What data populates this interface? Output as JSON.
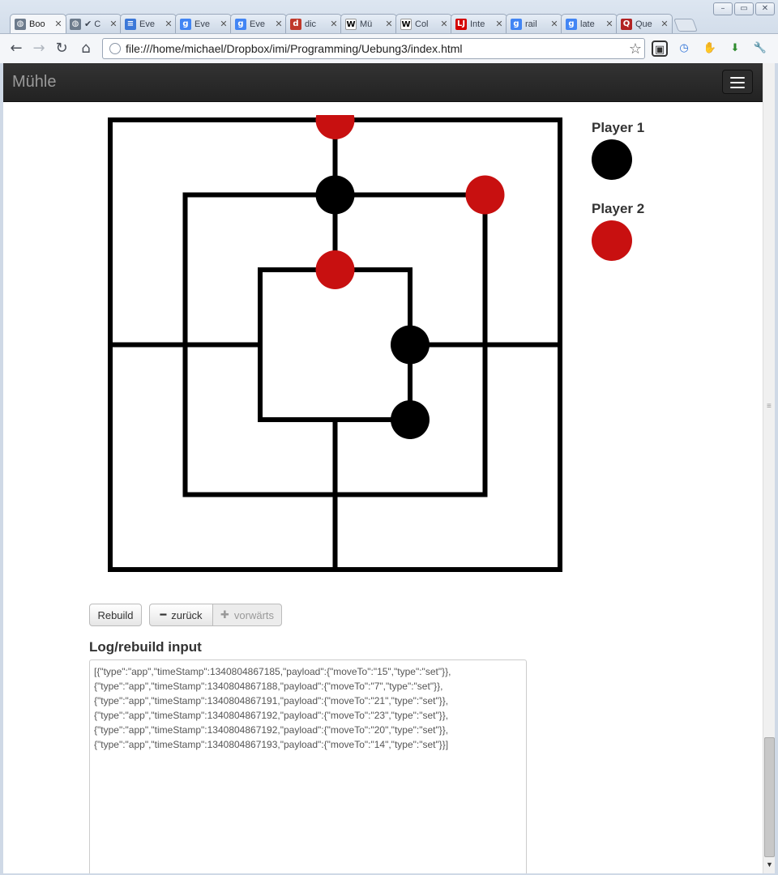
{
  "browser": {
    "tabs": [
      {
        "title": "Boo",
        "favicon": "globe-icon",
        "color": "#6d7b8c",
        "active": true
      },
      {
        "title": "✔ C",
        "favicon": "globe-icon",
        "color": "#6d7b8c",
        "active": false
      },
      {
        "title": "Eve",
        "favicon": "docs-icon",
        "color": "#3c78d8",
        "active": false
      },
      {
        "title": "Eve",
        "favicon": "google-icon",
        "color": "#4285f4",
        "active": false
      },
      {
        "title": "Eve",
        "favicon": "google-icon",
        "color": "#4285f4",
        "active": false
      },
      {
        "title": "dic",
        "favicon": "dict-icon",
        "color": "#c0392b",
        "active": false
      },
      {
        "title": "Mü",
        "favicon": "wikipedia-icon",
        "color": "#ffffff",
        "active": false
      },
      {
        "title": "Col",
        "favicon": "wikipedia-icon",
        "color": "#ffffff",
        "active": false
      },
      {
        "title": "Inte",
        "favicon": "lj-icon",
        "color": "#d40000",
        "active": false
      },
      {
        "title": "rail",
        "favicon": "google-icon",
        "color": "#4285f4",
        "active": false
      },
      {
        "title": "late",
        "favicon": "google-icon",
        "color": "#4285f4",
        "active": false
      },
      {
        "title": "Que",
        "favicon": "quest-icon",
        "color": "#b22222",
        "active": false
      }
    ],
    "address": "file:///home/michael/Dropbox/imi/Programming/Uebung3/index.html"
  },
  "app": {
    "brand": "Mühle",
    "menu_icon": "hamburger-menu-icon"
  },
  "board": {
    "line_color": "#000000",
    "black_color": "#000000",
    "red_color": "#c81010",
    "pieces": [
      {
        "ring": 0,
        "col": 1,
        "row": 0,
        "player": 2
      },
      {
        "ring": 1,
        "col": 1,
        "row": 0,
        "player": 1
      },
      {
        "ring": 1,
        "col": 2,
        "row": 0,
        "player": 2
      },
      {
        "ring": 2,
        "col": 1,
        "row": 0,
        "player": 2
      },
      {
        "ring": 2,
        "col": 2,
        "row": 1,
        "player": 1
      },
      {
        "ring": 2,
        "col": 2,
        "row": 2,
        "player": 1
      }
    ]
  },
  "players": {
    "p1_label": "Player 1",
    "p2_label": "Player 2",
    "p1_color": "#000000",
    "p2_color": "#c81010"
  },
  "controls": {
    "rebuild": "Rebuild",
    "back": "zurück",
    "forward": "vorwärts",
    "back_icon": "minus-icon",
    "forward_icon": "plus-icon"
  },
  "log": {
    "heading": "Log/rebuild input",
    "text": "[{\"type\":\"app\",\"timeStamp\":1340804867185,\"payload\":{\"moveTo\":\"15\",\"type\":\"set\"}},\n{\"type\":\"app\",\"timeStamp\":1340804867188,\"payload\":{\"moveTo\":\"7\",\"type\":\"set\"}},\n{\"type\":\"app\",\"timeStamp\":1340804867191,\"payload\":{\"moveTo\":\"21\",\"type\":\"set\"}},\n{\"type\":\"app\",\"timeStamp\":1340804867192,\"payload\":{\"moveTo\":\"23\",\"type\":\"set\"}},\n{\"type\":\"app\",\"timeStamp\":1340804867192,\"payload\":{\"moveTo\":\"20\",\"type\":\"set\"}},\n{\"type\":\"app\",\"timeStamp\":1340804867193,\"payload\":{\"moveTo\":\"14\",\"type\":\"set\"}}]"
  }
}
